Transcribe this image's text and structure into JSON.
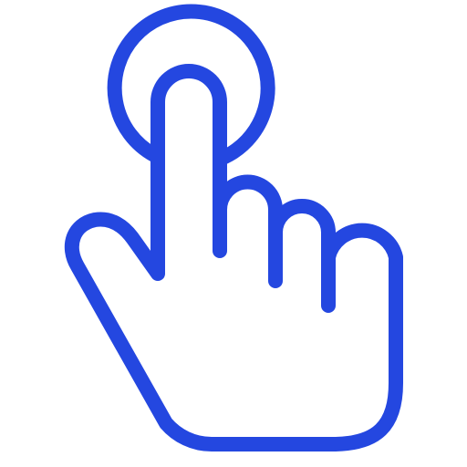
{
  "icon": {
    "name": "tap-gesture-icon",
    "parts": [
      "tap-ripple-circle",
      "pointing-hand"
    ],
    "stroke_color": "#2447E0",
    "background_color": "#FFFFFF"
  }
}
